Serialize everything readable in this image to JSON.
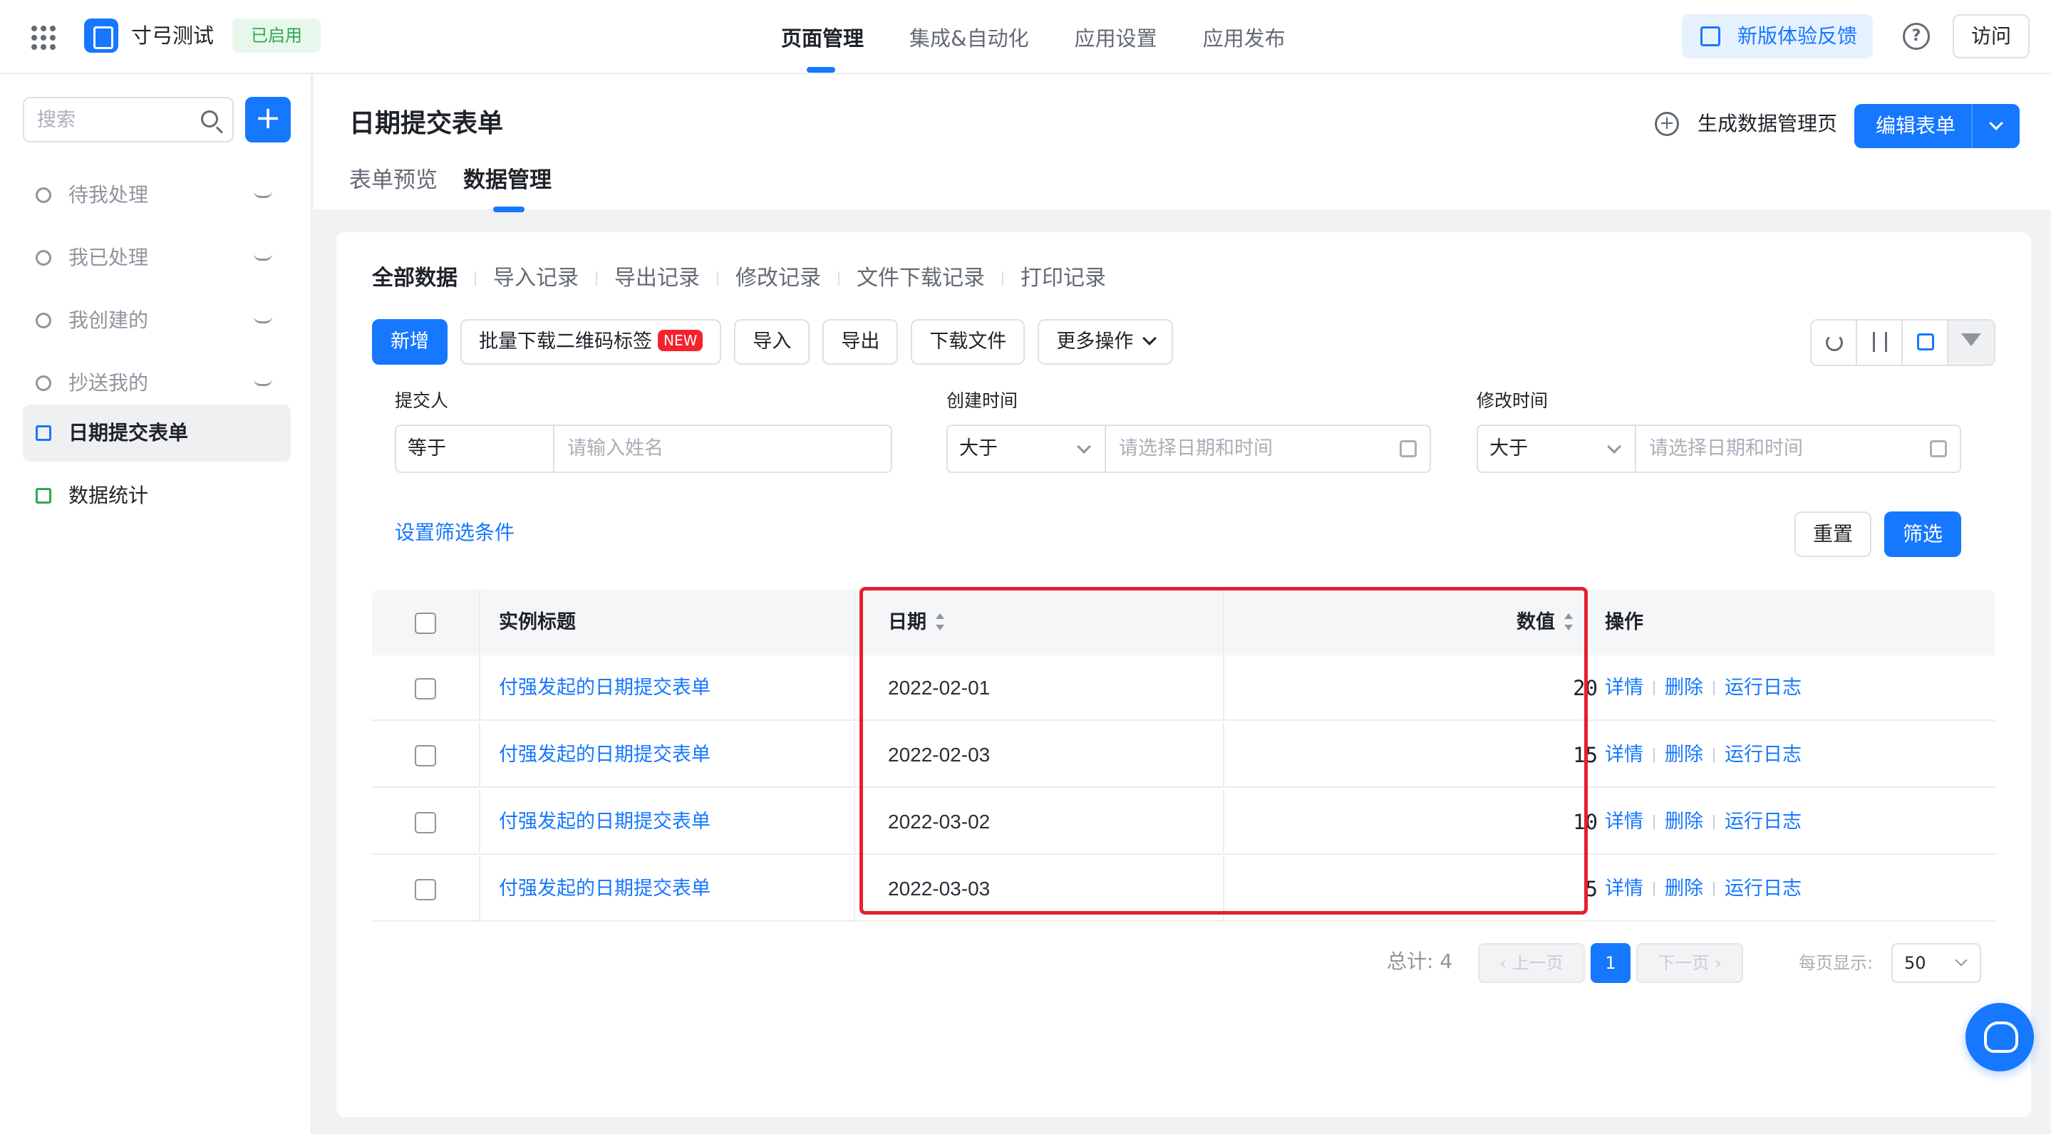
{
  "topbar": {
    "app_name": "寸弓测试",
    "status": "已启用",
    "nav": [
      "页面管理",
      "集成&自动化",
      "应用设置",
      "应用发布"
    ],
    "active_nav": "页面管理",
    "feedback": "新版体验反馈",
    "help": "?",
    "visit": "访问"
  },
  "sidebar": {
    "search_placeholder": "搜索",
    "add": "+",
    "items": [
      {
        "label": "待我处理"
      },
      {
        "label": "我已处理"
      },
      {
        "label": "我创建的"
      },
      {
        "label": "抄送我的"
      },
      {
        "label": "日期提交表单"
      },
      {
        "label": "数据统计"
      }
    ]
  },
  "page": {
    "title": "日期提交表单",
    "generate": "生成数据管理页",
    "edit": "编辑表单",
    "tabs": [
      "表单预览",
      "数据管理"
    ],
    "active_tab": "数据管理"
  },
  "card": {
    "sub_tabs": [
      "全部数据",
      "导入记录",
      "导出记录",
      "修改记录",
      "文件下载记录",
      "打印记录"
    ],
    "toolbar": {
      "add": "新增",
      "batch_download": "批量下载二维码标签",
      "new_badge": "NEW",
      "import": "导入",
      "export": "导出",
      "download": "下载文件",
      "more": "更多操作"
    },
    "filters": {
      "submitter": {
        "label": "提交人",
        "op": "等于",
        "placeholder": "请输入姓名"
      },
      "created": {
        "label": "创建时间",
        "op": "大于",
        "placeholder": "请选择日期和时间"
      },
      "modified": {
        "label": "修改时间",
        "op": "大于",
        "placeholder": "请选择日期和时间"
      }
    },
    "set_filter": "设置筛选条件",
    "reset": "重置",
    "filter": "筛选",
    "table": {
      "headers": [
        "实例标题",
        "日期",
        "数值",
        "操作"
      ],
      "rows": [
        {
          "title": "付强发起的日期提交表单",
          "date": "2022-02-01",
          "value": "20"
        },
        {
          "title": "付强发起的日期提交表单",
          "date": "2022-02-03",
          "value": "15"
        },
        {
          "title": "付强发起的日期提交表单",
          "date": "2022-03-02",
          "value": "10"
        },
        {
          "title": "付强发起的日期提交表单",
          "date": "2022-03-03",
          "value": "5"
        }
      ],
      "ops": [
        "详情",
        "删除",
        "运行日志"
      ]
    },
    "pagination": {
      "total": "总计: 4",
      "prev": "上一页",
      "page": "1",
      "next": "下一页",
      "per_page_label": "每页显示:",
      "per_page": "50"
    }
  },
  "colors": {
    "accent": "#1677ff",
    "highlight": "#e5202f",
    "status_green": "#2eaa4f"
  }
}
